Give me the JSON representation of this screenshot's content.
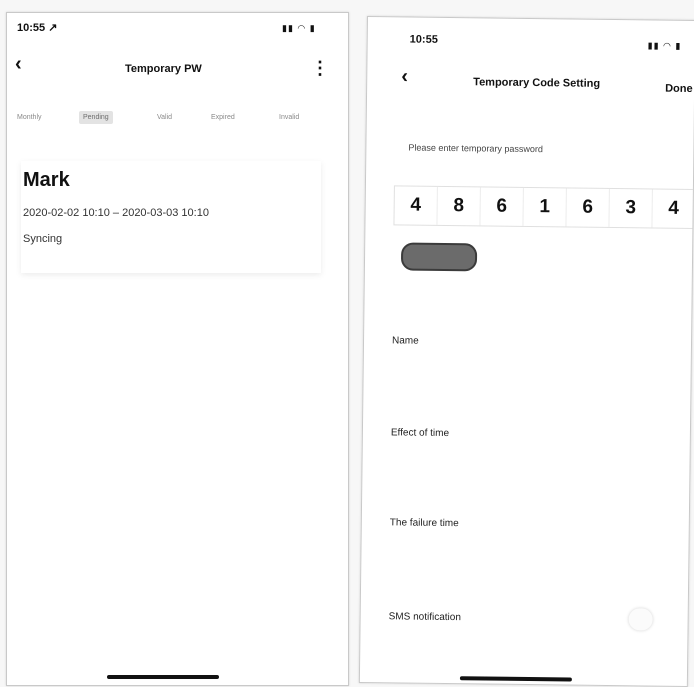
{
  "left_screen": {
    "status": {
      "time": "10:55 ↗",
      "icons": "▮▮ ◠ ▮"
    },
    "nav": {
      "back": "‹",
      "title": "Temporary PW",
      "more": "⋮"
    },
    "tabs": [
      {
        "label": "Monthly",
        "active": false
      },
      {
        "label": "Pending",
        "active": true
      },
      {
        "label": "Valid",
        "active": false
      },
      {
        "label": "Expired",
        "active": false
      },
      {
        "label": "Invalid",
        "active": false
      }
    ],
    "record": {
      "name": "Mark",
      "range": "2020-02-02 10:10 – 2020-03-03 10:10",
      "status": "Syncing"
    }
  },
  "right_screen": {
    "status": {
      "time": "10:55",
      "icons": "▮▮ ◠ ▮"
    },
    "nav": {
      "back": "‹",
      "title": "Temporary Code Setting",
      "done": "Done"
    },
    "prompt": "Please enter temporary password",
    "code_digits": [
      "4",
      "8",
      "6",
      "1",
      "6",
      "3",
      "4"
    ],
    "generate_button_label": "",
    "fields": {
      "name_label": "Name",
      "effect_label": "Effect of time",
      "failure_label": "The failure time",
      "sms_label": "SMS notification"
    },
    "sms_enabled": false
  }
}
